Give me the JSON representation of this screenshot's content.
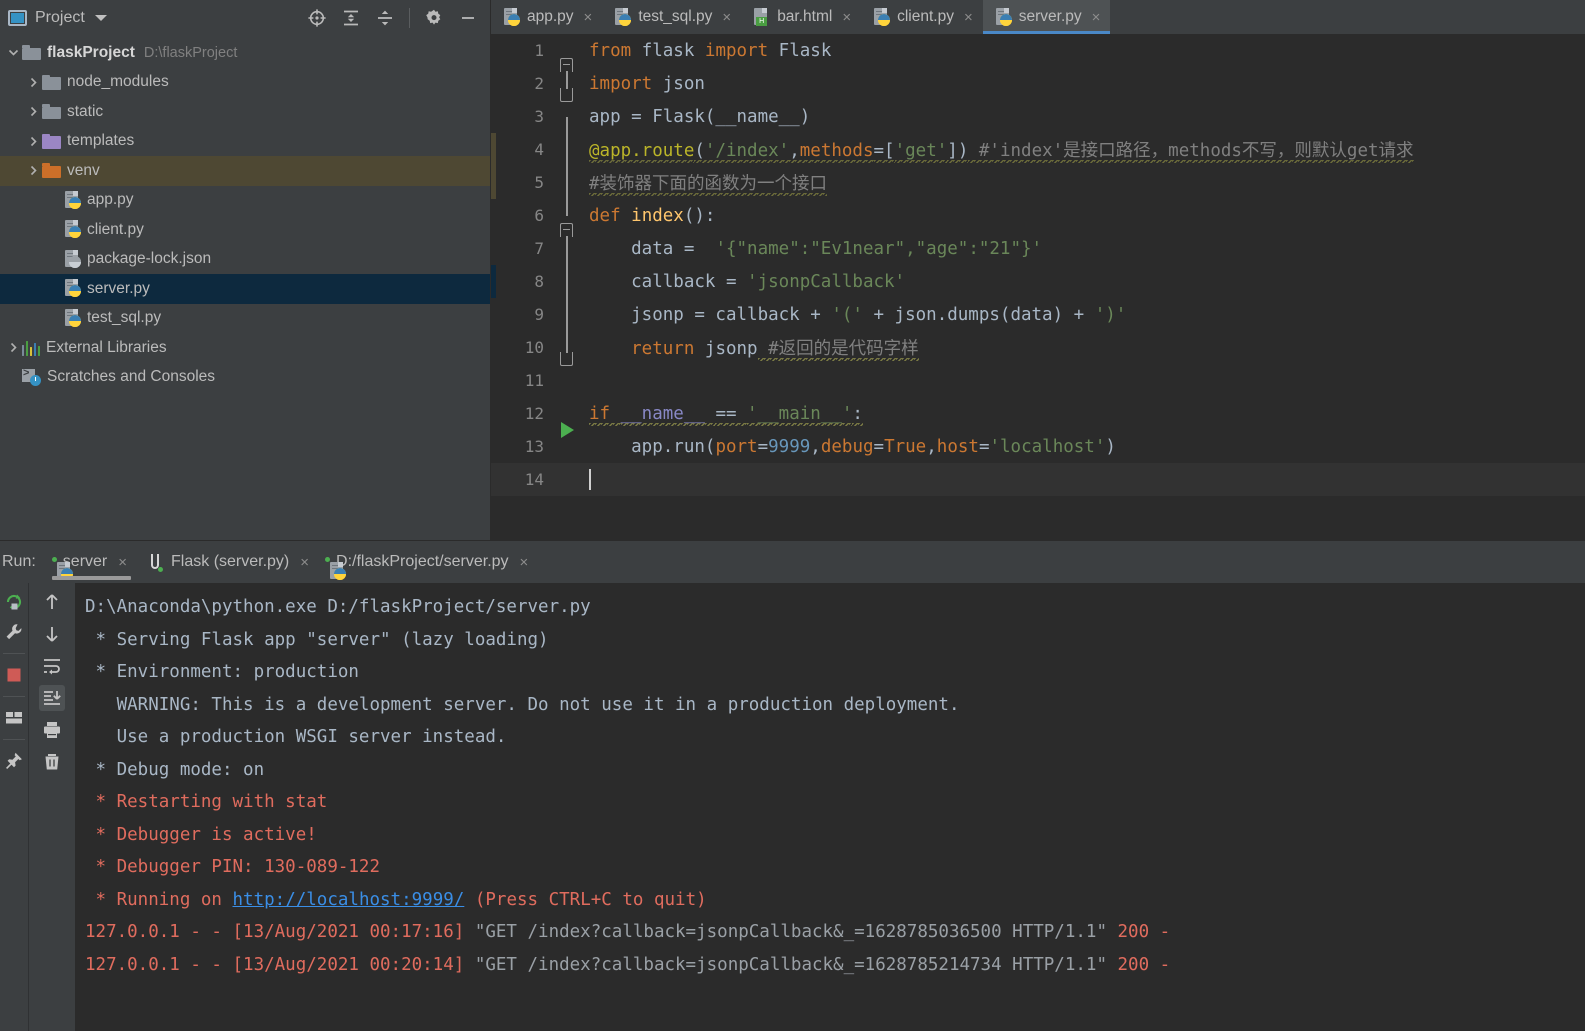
{
  "project_panel": {
    "title": "Project",
    "tools": [
      "locate-target-icon",
      "expand-all-icon",
      "collapse-all-icon",
      "settings-gear-icon",
      "minimize-icon"
    ],
    "tree": [
      {
        "label": "flaskProject",
        "path": "D:\\flaskProject",
        "kind": "folder-gray",
        "depth": 0,
        "arrow": "down",
        "bold": true,
        "state": "none"
      },
      {
        "label": "node_modules",
        "path": "",
        "kind": "folder-gray",
        "depth": 1,
        "arrow": "right",
        "bold": false,
        "state": "none"
      },
      {
        "label": "static",
        "path": "",
        "kind": "folder-gray",
        "depth": 1,
        "arrow": "right",
        "bold": false,
        "state": "none"
      },
      {
        "label": "templates",
        "path": "",
        "kind": "folder-purple",
        "depth": 1,
        "arrow": "right",
        "bold": false,
        "state": "none"
      },
      {
        "label": "venv",
        "path": "",
        "kind": "folder-orange",
        "depth": 1,
        "arrow": "right",
        "bold": false,
        "state": "hover"
      },
      {
        "label": "app.py",
        "path": "",
        "kind": "python",
        "depth": 2,
        "arrow": "none",
        "bold": false,
        "state": "none"
      },
      {
        "label": "client.py",
        "path": "",
        "kind": "python",
        "depth": 2,
        "arrow": "none",
        "bold": false,
        "state": "none"
      },
      {
        "label": "package-lock.json",
        "path": "",
        "kind": "json",
        "depth": 2,
        "arrow": "none",
        "bold": false,
        "state": "none"
      },
      {
        "label": "server.py",
        "path": "",
        "kind": "python",
        "depth": 2,
        "arrow": "none",
        "bold": false,
        "state": "selected"
      },
      {
        "label": "test_sql.py",
        "path": "",
        "kind": "python",
        "depth": 2,
        "arrow": "none",
        "bold": false,
        "state": "none"
      },
      {
        "label": "External Libraries",
        "path": "",
        "kind": "libraries",
        "depth": 0,
        "arrow": "right",
        "bold": false,
        "state": "none"
      },
      {
        "label": "Scratches and Consoles",
        "path": "",
        "kind": "scratches",
        "depth": 0,
        "arrow": "none",
        "bold": false,
        "state": "none"
      }
    ]
  },
  "editor": {
    "tabs": [
      {
        "label": "app.py",
        "icon": "python-file-icon",
        "active": false
      },
      {
        "label": "test_sql.py",
        "icon": "python-file-icon",
        "active": false
      },
      {
        "label": "bar.html",
        "icon": "html-file-icon",
        "active": false
      },
      {
        "label": "client.py",
        "icon": "python-file-icon",
        "active": false
      },
      {
        "label": "server.py",
        "icon": "python-file-icon",
        "active": true
      }
    ],
    "close_glyph": "×",
    "lines": [
      {
        "n": "1",
        "fold": "top",
        "marker": "",
        "current": false,
        "tokens": [
          {
            "t": "from ",
            "c": "kw"
          },
          {
            "t": "flask ",
            "c": "plain"
          },
          {
            "t": "import ",
            "c": "kw"
          },
          {
            "t": "Flask",
            "c": "plain"
          }
        ]
      },
      {
        "n": "2",
        "fold": "bottom",
        "marker": "",
        "current": false,
        "tokens": [
          {
            "t": "import ",
            "c": "kw"
          },
          {
            "t": "json",
            "c": "plain"
          }
        ]
      },
      {
        "n": "3",
        "fold": "line",
        "marker": "",
        "current": false,
        "tokens": [
          {
            "t": "app = Flask(__name__)",
            "c": "plain"
          }
        ]
      },
      {
        "n": "4",
        "fold": "line",
        "marker": "olive",
        "current": false,
        "tokens": [
          {
            "t": "@app.route",
            "c": "deco wavy-y"
          },
          {
            "t": "(",
            "c": "plain wavy-y"
          },
          {
            "t": "'/index'",
            "c": "str wavy-y"
          },
          {
            "t": ",",
            "c": "plain wavy-y"
          },
          {
            "t": "methods",
            "c": "kwarg wavy-y"
          },
          {
            "t": "=[",
            "c": "plain wavy-y"
          },
          {
            "t": "'get'",
            "c": "str wavy-y"
          },
          {
            "t": "])",
            "c": "plain wavy-y"
          },
          {
            "t": " #'index'是接口路径，methods不写，则默认get请求",
            "c": "comment wavy-y"
          }
        ]
      },
      {
        "n": "5",
        "fold": "line",
        "marker": "olive",
        "current": false,
        "tokens": [
          {
            "t": "#装饰器下面的函数为一个接口",
            "c": "comment wavy-y"
          }
        ]
      },
      {
        "n": "6",
        "fold": "top",
        "marker": "",
        "current": false,
        "tokens": [
          {
            "t": "def ",
            "c": "kw"
          },
          {
            "t": "index",
            "c": "fn"
          },
          {
            "t": "():",
            "c": "plain"
          }
        ]
      },
      {
        "n": "7",
        "fold": "line",
        "marker": "",
        "current": false,
        "tokens": [
          {
            "t": "    data = ",
            "c": "plain"
          },
          {
            "t": " ",
            "c": "plain"
          },
          {
            "t": "'{\"name\":\"Ev1near\",\"age\":\"21\"}'",
            "c": "str"
          }
        ]
      },
      {
        "n": "8",
        "fold": "line",
        "marker": "blue",
        "current": false,
        "tokens": [
          {
            "t": "    callback = ",
            "c": "plain"
          },
          {
            "t": "'jsonpCallback'",
            "c": "str"
          }
        ]
      },
      {
        "n": "9",
        "fold": "line",
        "marker": "",
        "current": false,
        "tokens": [
          {
            "t": "    jsonp = callback + ",
            "c": "plain"
          },
          {
            "t": "'('",
            "c": "str"
          },
          {
            "t": " + json.dumps(data) + ",
            "c": "plain"
          },
          {
            "t": "')'",
            "c": "str"
          }
        ]
      },
      {
        "n": "10",
        "fold": "bottom",
        "marker": "",
        "current": false,
        "tokens": [
          {
            "t": "    return ",
            "c": "kw"
          },
          {
            "t": "jsonp",
            "c": "plain"
          },
          {
            "t": " #返回的是代码字样",
            "c": "comment wavy-g"
          }
        ]
      },
      {
        "n": "11",
        "fold": "none",
        "marker": "",
        "current": false,
        "tokens": []
      },
      {
        "n": "12",
        "fold": "run",
        "marker": "",
        "current": false,
        "tokens": [
          {
            "t": "if ",
            "c": "kw wavy-g"
          },
          {
            "t": "__name__ ",
            "c": "builtin wavy-g"
          },
          {
            "t": "== ",
            "c": "plain wavy-g"
          },
          {
            "t": "'__main__'",
            "c": "str wavy-g"
          },
          {
            "t": ":",
            "c": "plain wavy-g"
          }
        ]
      },
      {
        "n": "13",
        "fold": "none",
        "marker": "",
        "current": false,
        "tokens": [
          {
            "t": "    app.run(",
            "c": "plain"
          },
          {
            "t": "port",
            "c": "kwarg"
          },
          {
            "t": "=",
            "c": "plain"
          },
          {
            "t": "9999",
            "c": "num"
          },
          {
            "t": ",",
            "c": "plain"
          },
          {
            "t": "debug",
            "c": "kwarg"
          },
          {
            "t": "=",
            "c": "plain"
          },
          {
            "t": "True",
            "c": "kw"
          },
          {
            "t": ",",
            "c": "plain"
          },
          {
            "t": "host",
            "c": "kwarg"
          },
          {
            "t": "=",
            "c": "plain"
          },
          {
            "t": "'localhost'",
            "c": "str"
          },
          {
            "t": ")",
            "c": "plain"
          }
        ]
      },
      {
        "n": "14",
        "fold": "none",
        "marker": "",
        "current": true,
        "caret": true,
        "tokens": []
      }
    ]
  },
  "run_panel": {
    "label": "Run:",
    "close_glyph": "×",
    "tabs": [
      {
        "label": "server",
        "icon": "python-run-icon",
        "active": true
      },
      {
        "label": "Flask (server.py)",
        "icon": "flask-run-icon",
        "active": false
      },
      {
        "label": "D:/flaskProject/server.py",
        "icon": "python-run-icon",
        "active": false
      }
    ],
    "left_tools": [
      "rerun-icon",
      "settings-wrench-icon",
      "stop-icon",
      "layout-icon",
      "pin-icon"
    ],
    "right_tools": [
      "arrow-up-icon",
      "arrow-down-icon",
      "soft-wrap-icon",
      "scroll-to-end-icon",
      "print-icon",
      "trash-icon"
    ],
    "console": [
      {
        "segments": [
          {
            "t": "D:\\Anaconda\\python.exe D:/flaskProject/server.py",
            "c": "c-gray"
          }
        ]
      },
      {
        "segments": [
          {
            "t": " * Serving Flask app \"server\" (lazy loading)",
            "c": "c-gray"
          }
        ]
      },
      {
        "segments": [
          {
            "t": " * Environment: production",
            "c": "c-gray"
          }
        ]
      },
      {
        "segments": [
          {
            "t": "   WARNING: This is a development server. Do not use it in a production deployment.",
            "c": "c-gray"
          }
        ]
      },
      {
        "segments": [
          {
            "t": "   Use a production WSGI server instead.",
            "c": "c-gray"
          }
        ]
      },
      {
        "segments": [
          {
            "t": " * Debug mode: on",
            "c": "c-gray"
          }
        ]
      },
      {
        "segments": [
          {
            "t": " * Restarting with stat",
            "c": "c-red"
          }
        ]
      },
      {
        "segments": [
          {
            "t": " * Debugger is active!",
            "c": "c-red"
          }
        ]
      },
      {
        "segments": [
          {
            "t": " * Debugger PIN: 130-089-122",
            "c": "c-red"
          }
        ]
      },
      {
        "segments": [
          {
            "t": " * Running on ",
            "c": "c-red"
          },
          {
            "t": "http://localhost:9999/",
            "c": "c-link"
          },
          {
            "t": " (Press CTRL+C to quit)",
            "c": "c-red"
          }
        ]
      },
      {
        "segments": [
          {
            "t": "127.0.0.1 - - [13/Aug/2021 00:17:16] ",
            "c": "c-red"
          },
          {
            "t": "\"GET /index?callback=jsonpCallback&_=1628785036500 HTTP/1.1\"",
            "c": "c-dim"
          },
          {
            "t": " 200 -",
            "c": "c-red"
          }
        ]
      },
      {
        "segments": [
          {
            "t": "127.0.0.1 - - [13/Aug/2021 00:20:14] ",
            "c": "c-red"
          },
          {
            "t": "\"GET /index?callback=jsonpCallback&_=1628785214734 HTTP/1.1\"",
            "c": "c-dim"
          },
          {
            "t": " 200 -",
            "c": "c-red"
          }
        ]
      }
    ]
  },
  "colors": {
    "panel_bg": "#3c3f41",
    "editor_bg": "#2b2b2b",
    "selection_blue": "#0d293e",
    "tab_active_underline": "#4a88c7",
    "error_red": "#e06c5e",
    "link_blue": "#3a8ee6"
  }
}
